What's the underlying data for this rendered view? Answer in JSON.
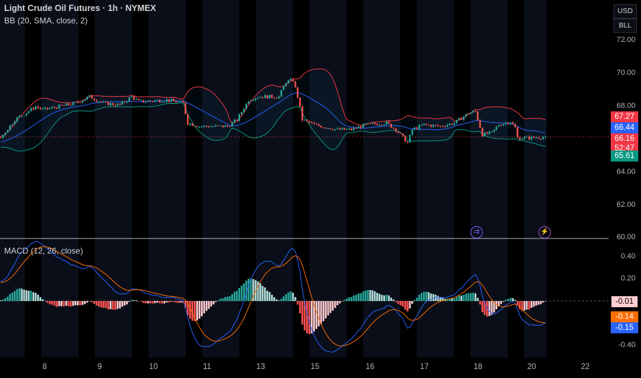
{
  "header": {
    "title": "Light Crude Oil Futures · 1h · NYMEX",
    "bb_legend": "BB (20, SMA, close, 2)",
    "macd_legend": "MACD (12, 26, close)",
    "currency_button": "USD",
    "unit_button": "BLL"
  },
  "price_axis": [
    "72.00",
    "70.00",
    "68.00",
    "64.00",
    "62.00",
    "60.00"
  ],
  "price_tags": {
    "bb_upper": "67.27",
    "bb_basis": "66.44",
    "last_price": "66.16",
    "countdown": "52:47",
    "bb_lower": "65.61"
  },
  "macd_axis": [
    "0.40",
    "0.20",
    "-0.40"
  ],
  "macd_tags": {
    "histogram": "-0.01",
    "signal": "-0.14",
    "macd": "-0.15"
  },
  "x_axis": [
    "8",
    "9",
    "10",
    "11",
    "13",
    "15",
    "16",
    "17",
    "18",
    "20",
    "22"
  ],
  "events": [
    {
      "icon": "arrows-icon",
      "symbol": "⇉"
    },
    {
      "icon": "lightning-icon",
      "symbol": "⚡"
    }
  ],
  "colors": {
    "up": "#26a69a",
    "down": "#ef5350",
    "bb_upper": "#f23645",
    "bb_basis": "#2962ff",
    "bb_lower": "#089981",
    "macd": "#2962ff",
    "signal": "#ff6d00"
  },
  "chart_data": {
    "type": "candlestick",
    "title": "Light Crude Oil Futures · 1h · NYMEX",
    "ylim": [
      60,
      72
    ],
    "macd_ylim": [
      -0.5,
      0.5
    ],
    "close_keypoints_hour_price": [
      [
        -40,
        65.0
      ],
      [
        -20,
        65.6
      ],
      [
        0,
        66.1
      ],
      [
        6,
        67.2
      ],
      [
        15,
        68.0
      ],
      [
        18,
        67.8
      ],
      [
        32,
        68.2
      ],
      [
        38,
        68.6
      ],
      [
        44,
        68.2
      ],
      [
        51,
        68.1
      ],
      [
        56,
        68.6
      ],
      [
        59,
        68.3
      ],
      [
        71,
        68.4
      ],
      [
        78,
        68.2
      ],
      [
        80,
        67.0
      ],
      [
        85,
        66.8
      ],
      [
        97,
        66.8
      ],
      [
        101,
        67.2
      ],
      [
        106,
        68.4
      ],
      [
        110,
        68.6
      ],
      [
        119,
        68.6
      ],
      [
        122,
        69.5
      ],
      [
        125,
        69.6
      ],
      [
        127,
        68.6
      ],
      [
        129,
        67.2
      ],
      [
        134,
        66.9
      ],
      [
        144,
        66.6
      ],
      [
        150,
        66.6
      ],
      [
        156,
        66.9
      ],
      [
        165,
        67.0
      ],
      [
        169,
        66.6
      ],
      [
        174,
        65.8
      ],
      [
        176,
        66.6
      ],
      [
        181,
        66.9
      ],
      [
        188,
        66.8
      ],
      [
        194,
        67.0
      ],
      [
        200,
        67.6
      ],
      [
        203,
        67.7
      ],
      [
        206,
        66.3
      ],
      [
        210,
        66.4
      ],
      [
        213,
        66.9
      ],
      [
        218,
        67.1
      ],
      [
        220,
        66.7
      ],
      [
        221,
        66.1
      ],
      [
        226,
        66.1
      ],
      [
        233,
        66.16
      ]
    ]
  }
}
